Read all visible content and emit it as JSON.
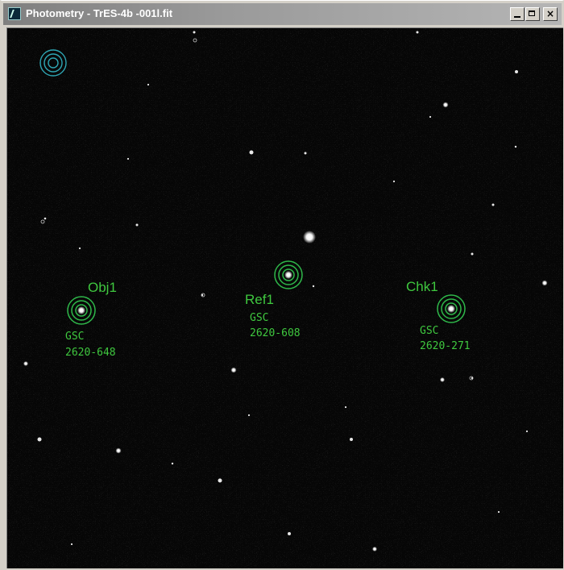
{
  "window": {
    "title": "Photometry - TrES-4b -001l.fit",
    "buttons": {
      "minimize": "minimize",
      "maximize": "maximize",
      "close": "×"
    }
  },
  "targets": [
    {
      "label": "Obj1",
      "catalog": "GSC",
      "id": "2620-648"
    },
    {
      "label": "Ref1",
      "catalog": "GSC",
      "id": "2620-608"
    },
    {
      "label": "Chk1",
      "catalog": "GSC",
      "id": "2620-271"
    }
  ],
  "colors": {
    "aperture": "#2fb84a",
    "label": "#3fc83f",
    "cursor_aperture": "#2fa7b5"
  }
}
